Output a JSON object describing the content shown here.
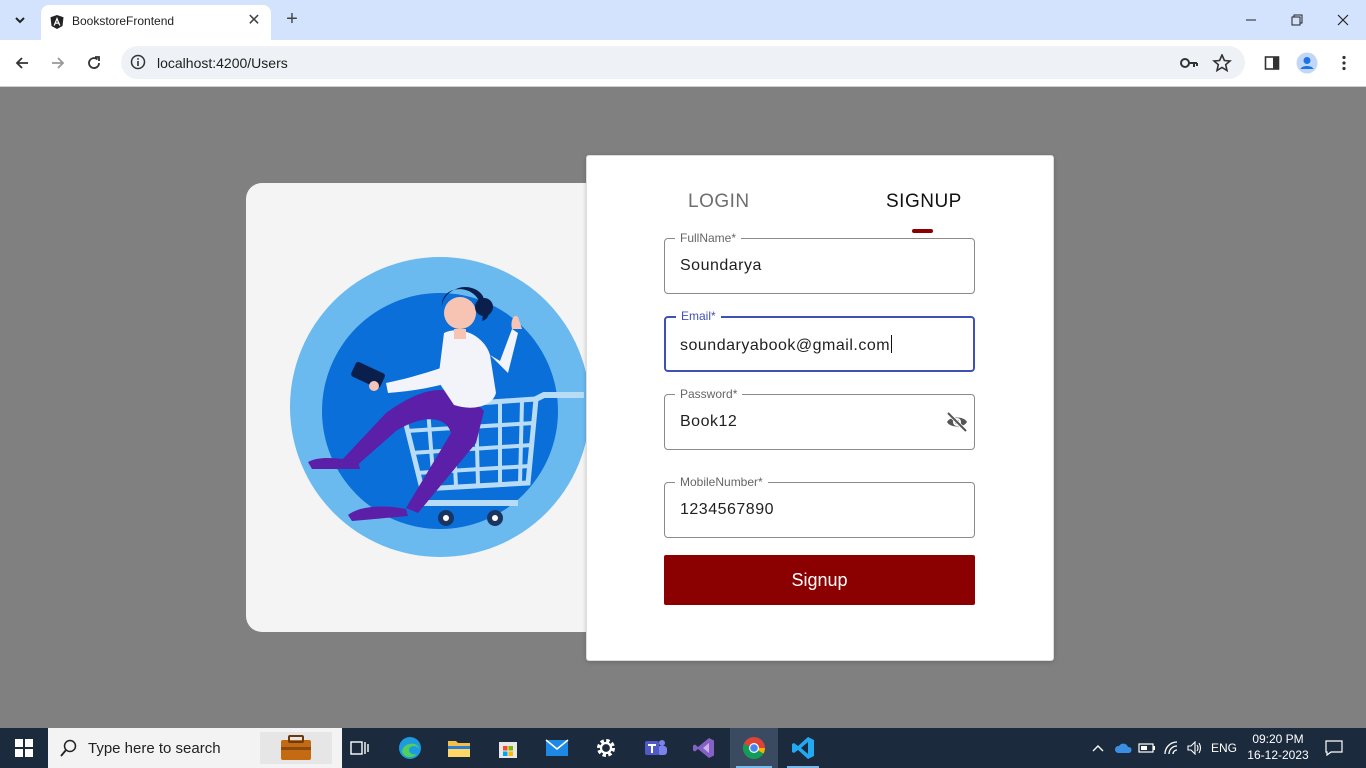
{
  "browser": {
    "tab_title": "BookstoreFrontend",
    "url": "localhost:4200/Users"
  },
  "auth": {
    "tabs": [
      {
        "label": "LOGIN",
        "active": false
      },
      {
        "label": "SIGNUP",
        "active": true
      }
    ],
    "fields": {
      "fullname": {
        "label": "FullName*",
        "value": "Soundarya"
      },
      "email": {
        "label": "Email*",
        "value": "soundaryabook@gmail.com"
      },
      "password": {
        "label": "Password*",
        "value": "Book12"
      },
      "mobile": {
        "label": "MobileNumber*",
        "value": "1234567890"
      }
    },
    "submit_label": "Signup"
  },
  "taskbar": {
    "search_placeholder": "Type here to search",
    "language": "ENG",
    "time": "09:20 PM",
    "date": "16-12-2023"
  },
  "colors": {
    "accent": "#8b0000",
    "focus": "#3f51b5",
    "page_bg": "#808080"
  }
}
